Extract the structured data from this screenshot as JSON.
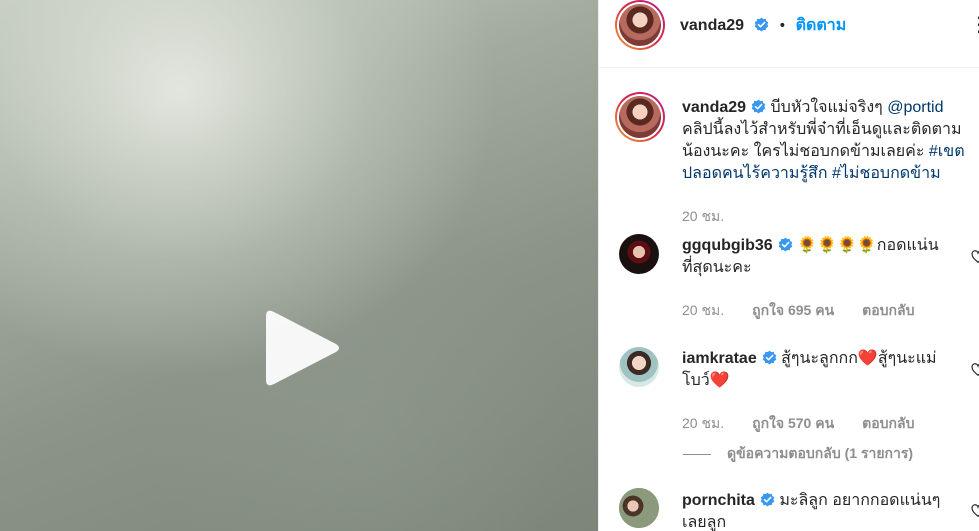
{
  "post": {
    "author": "vanda29",
    "follow_label": "ติดตาม",
    "separator": "•",
    "more_label": "⋮"
  },
  "caption": {
    "username": "vanda29",
    "text_1": "บีบหัวใจแม่จริงๆ ",
    "mention": "@portid",
    "text_2": " คลิปนี้ลงไว้สำหรับพี่จ๋าที่เอ็นดูและติดตามน้องนะคะ ใครไม่ชอบกดข้ามเลยค่ะ ",
    "hashtag_1": "#เขตปลอดคนไร้ความรู้สึก",
    "space": " ",
    "hashtag_2": "#ไม่ชอบกดข้าม",
    "time": "20 ชม."
  },
  "comments": [
    {
      "username": "ggqubgib36",
      "text": " 🌻🌻🌻🌻กอดแน่นที่สุดนะคะ",
      "time": "20 ชม.",
      "likes": "ถูกใจ 695 คน",
      "reply_label": "ตอบกลับ"
    },
    {
      "username": "iamkratae",
      "text": " สู้ๆนะลูกกก❤️สู้ๆนะแม่โบว์❤️",
      "time": "20 ชม.",
      "likes": "ถูกใจ 570 คน",
      "reply_label": "ตอบกลับ",
      "view_replies": "ดูข้อความตอบกลับ (1 รายการ)"
    },
    {
      "username": "pornchita",
      "text": " มะลิลูก อยากกอดแน่นๆ เลยลูก"
    }
  ],
  "colors": {
    "accent": "#0095f6",
    "link": "#00376b",
    "muted": "#8e8e8e",
    "verified": "#3897f0"
  },
  "icons": {
    "play": "play-icon",
    "verified": "verified-badge-icon",
    "heart": "heart-outline-icon",
    "more": "more-options-icon"
  }
}
